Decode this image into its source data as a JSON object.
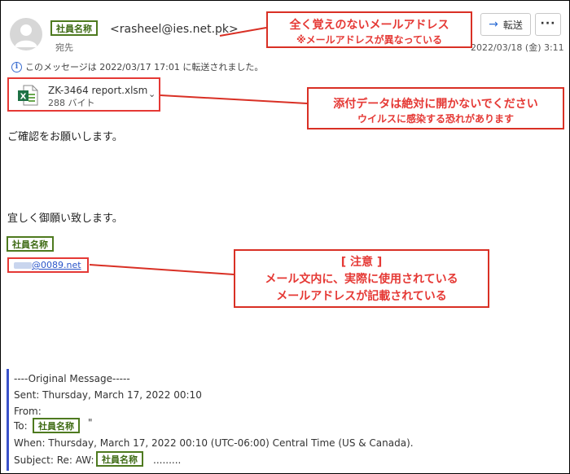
{
  "header": {
    "sender_name_badge": "社員名称",
    "sender_address": "<rasheel@ies.net.pk>",
    "to_label": "宛先",
    "forwarded_info": "このメッセージは 2022/03/17 17:01 に転送されました。",
    "date": "2022/03/18 (金) 3:11",
    "forward_label": "転送",
    "more_label": "···"
  },
  "attachment": {
    "file_name": "ZK-3464 report.xlsm",
    "file_size": "288 バイト"
  },
  "body": {
    "greeting": "ご確認をお願いします。",
    "closing": "宜しく御願い致します。",
    "signature_badge": "社員名称",
    "signature_email": "@0089.net"
  },
  "original_message": {
    "header_line": "----Original Message-----",
    "sent": "Sent: Thursday, March 17, 2022 00:10",
    "from": "From:",
    "to_prefix": "To:",
    "to_badge": "社員名称",
    "to_suffix": "\"",
    "when": "When: Thursday, March 17, 2022 00:10 (UTC-06:00) Central Time (US & Canada).",
    "subject_prefix": "Subject: Re: AW:",
    "subject_badge": "社員名称",
    "subject_suffix": "........."
  },
  "callouts": {
    "unknown_address": {
      "line1": "全く覚えのないメールアドレス",
      "line2": "※メールアドレスが異なっている"
    },
    "attachment_warning": {
      "line1": "添付データは絶対に開かないでください",
      "line2": "ウイルスに感染する恐れがあります"
    },
    "note": {
      "title": "[ 注意 ]",
      "line1": "メール文内に、実際に使用されている",
      "line2": "メールアドレスが記載されている"
    }
  },
  "colors": {
    "callout_red": "#e53935",
    "badge_green": "#4e7a1f",
    "link_blue": "#2a55c9",
    "quote_bar": "#3a52c9"
  }
}
